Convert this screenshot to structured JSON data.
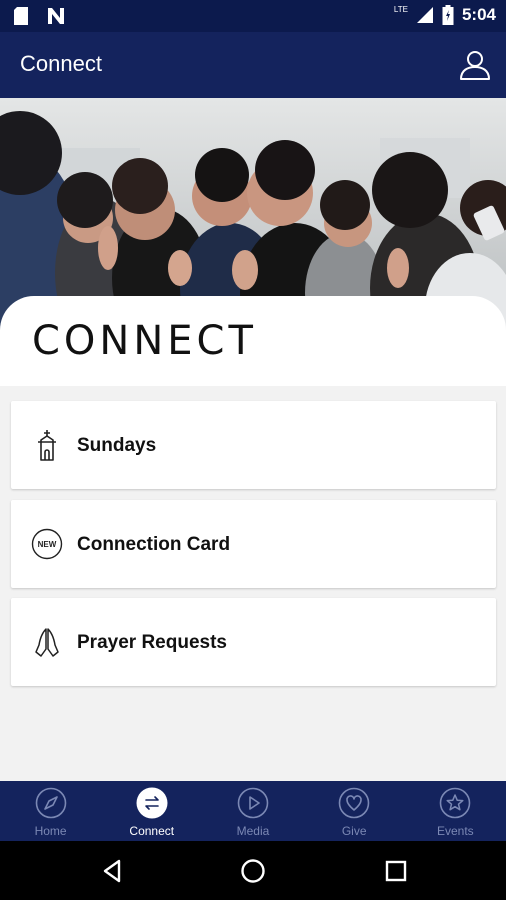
{
  "status_bar": {
    "time": "5:04",
    "network": "LTE"
  },
  "app_bar": {
    "title": "Connect"
  },
  "hero": {
    "title": "CONNECT"
  },
  "list": [
    {
      "label": "Sundays",
      "icon": "church-icon"
    },
    {
      "label": "Connection Card",
      "icon": "new-badge-icon",
      "badge": "NEW"
    },
    {
      "label": "Prayer Requests",
      "icon": "praying-hands-icon"
    }
  ],
  "bottom_nav": [
    {
      "label": "Home",
      "icon": "compass-icon",
      "active": false
    },
    {
      "label": "Connect",
      "icon": "connect-arrows-icon",
      "active": true
    },
    {
      "label": "Media",
      "icon": "play-icon",
      "active": false
    },
    {
      "label": "Give",
      "icon": "heart-icon",
      "active": false
    },
    {
      "label": "Events",
      "icon": "star-icon",
      "active": false
    }
  ],
  "colors": {
    "primary": "#14235d",
    "status": "#0c1a4d",
    "inactive": "#7b88b4",
    "background": "#f2f2f2"
  }
}
